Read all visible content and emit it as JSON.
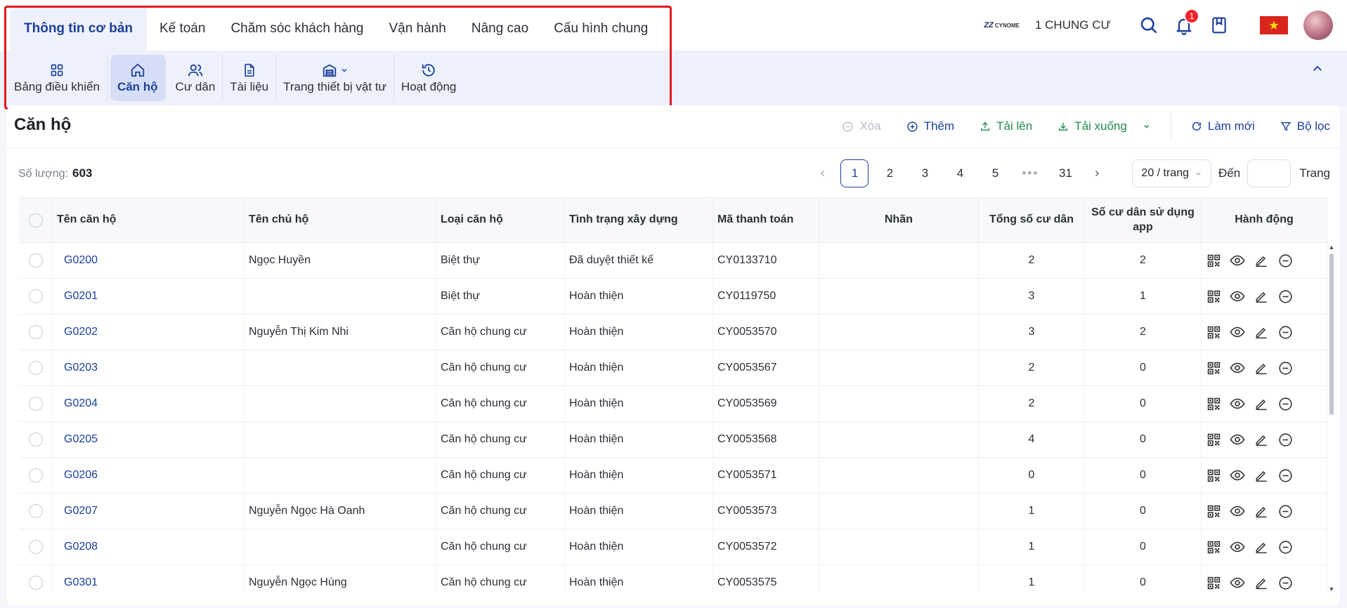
{
  "nav": {
    "tabs": [
      {
        "label": "Thông tin cơ bản",
        "active": true
      },
      {
        "label": "Kế toán"
      },
      {
        "label": "Chăm sóc khách hàng"
      },
      {
        "label": "Vận hành"
      },
      {
        "label": "Nâng cao"
      },
      {
        "label": "Cấu hình chung"
      }
    ],
    "brand_logo": "CYNOME",
    "building": "1 CHUNG CƯ",
    "notification_count": "1"
  },
  "subnav": {
    "items": [
      {
        "label": "Bảng điều khiển",
        "icon": "grid-icon"
      },
      {
        "label": "Căn hộ",
        "icon": "home-icon",
        "active": true
      },
      {
        "label": "Cư dân",
        "icon": "users-icon"
      },
      {
        "label": "Tài liệu",
        "icon": "document-icon"
      },
      {
        "label": "Trang thiết bị vật tư",
        "icon": "equipment-icon"
      },
      {
        "label": "Hoạt động",
        "icon": "history-icon"
      }
    ]
  },
  "page": {
    "title": "Căn hộ",
    "toolbar": {
      "delete": "Xóa",
      "add": "Thêm",
      "upload": "Tải lên",
      "download": "Tải xuống",
      "refresh": "Làm mới",
      "filter": "Bộ lọc"
    },
    "count_label": "Số lượng:",
    "count_value": "603"
  },
  "pagination": {
    "pages": [
      "1",
      "2",
      "3",
      "4",
      "5"
    ],
    "dots": "•••",
    "last": "31",
    "page_size": "20 / trang",
    "goto_label": "Đến",
    "goto_suffix": "Trang"
  },
  "table": {
    "headers": [
      "Tên căn hộ",
      "Tên chủ hộ",
      "Loại căn hộ",
      "Tình trạng xây dựng",
      "Mã thanh toán",
      "Nhãn",
      "Tổng số cư dân",
      "Số cư dân sử dụng app",
      "Hành động"
    ],
    "rows": [
      {
        "name": "G0200",
        "owner": "Ngọc Huyền",
        "type": "Biệt thự",
        "status": "Đã duyệt thiết kế",
        "code": "CY0133710",
        "tag": "",
        "total": "2",
        "app": "2"
      },
      {
        "name": "G0201",
        "owner": "",
        "type": "Biệt thự",
        "status": "Hoàn thiện",
        "code": "CY0119750",
        "tag": "",
        "total": "3",
        "app": "1"
      },
      {
        "name": "G0202",
        "owner": "Nguyễn Thị Kim Nhi",
        "type": "Căn hộ chung cư",
        "status": "Hoàn thiện",
        "code": "CY0053570",
        "tag": "",
        "total": "3",
        "app": "2"
      },
      {
        "name": "G0203",
        "owner": "",
        "type": "Căn hộ chung cư",
        "status": "Hoàn thiện",
        "code": "CY0053567",
        "tag": "",
        "total": "2",
        "app": "0"
      },
      {
        "name": "G0204",
        "owner": "",
        "type": "Căn hộ chung cư",
        "status": "Hoàn thiện",
        "code": "CY0053569",
        "tag": "",
        "total": "2",
        "app": "0"
      },
      {
        "name": "G0205",
        "owner": "",
        "type": "Căn hộ chung cư",
        "status": "Hoàn thiện",
        "code": "CY0053568",
        "tag": "",
        "total": "4",
        "app": "0"
      },
      {
        "name": "G0206",
        "owner": "",
        "type": "Căn hộ chung cư",
        "status": "Hoàn thiện",
        "code": "CY0053571",
        "tag": "",
        "total": "0",
        "app": "0"
      },
      {
        "name": "G0207",
        "owner": "Nguyễn Ngọc Hà Oanh",
        "type": "Căn hộ chung cư",
        "status": "Hoàn thiện",
        "code": "CY0053573",
        "tag": "",
        "total": "1",
        "app": "0"
      },
      {
        "name": "G0208",
        "owner": "",
        "type": "Căn hộ chung cư",
        "status": "Hoàn thiện",
        "code": "CY0053572",
        "tag": "",
        "total": "1",
        "app": "0"
      },
      {
        "name": "G0301",
        "owner": "Nguyễn Ngọc Hùng",
        "type": "Căn hộ chung cư",
        "status": "Hoàn thiện",
        "code": "CY0053575",
        "tag": "",
        "total": "1",
        "app": "0"
      }
    ]
  },
  "colors": {
    "accent": "#1a3f9c",
    "green": "#1f8a4c",
    "highlight": "#e0141e",
    "badge": "#f5222d"
  }
}
